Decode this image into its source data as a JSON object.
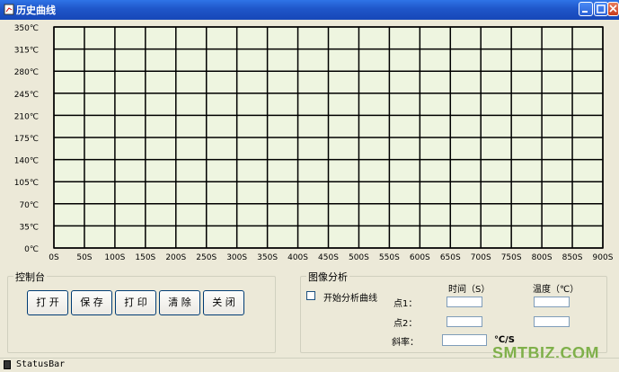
{
  "window": {
    "title": "历史曲线"
  },
  "chart_data": {
    "type": "line",
    "y_tick_labels": [
      "350℃",
      "315℃",
      "280℃",
      "245℃",
      "210℃",
      "175℃",
      "140℃",
      "105℃",
      "70℃",
      "35℃",
      "0℃"
    ],
    "x_tick_labels": [
      "0S",
      "50S",
      "100S",
      "150S",
      "200S",
      "250S",
      "300S",
      "350S",
      "400S",
      "450S",
      "500S",
      "550S",
      "600S",
      "650S",
      "700S",
      "750S",
      "800S",
      "850S",
      "900S"
    ],
    "xlim": [
      0,
      900
    ],
    "ylim": [
      0,
      350
    ],
    "grid": true,
    "series": [],
    "background": "#eef5e0"
  },
  "control": {
    "title": "控制台",
    "buttons": [
      "打 开",
      "保 存",
      "打 印",
      "清 除",
      "关 闭"
    ]
  },
  "analysis": {
    "title": "图像分析",
    "start_checkbox_label": "开始分析曲线",
    "time_header": "时间（S）",
    "temp_header": "温度（℃）",
    "point1_label": "点1：",
    "point2_label": "点2：",
    "slope_label": "斜率：",
    "slope_unit": "℃/S"
  },
  "status": {
    "text": "StatusBar"
  },
  "watermark": "SMTBIZ.COM"
}
